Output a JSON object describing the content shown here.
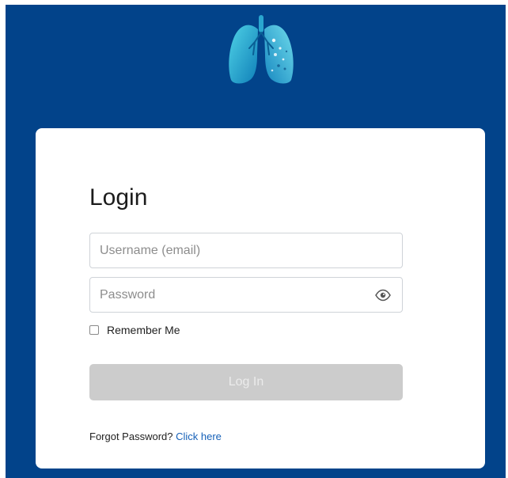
{
  "login": {
    "title": "Login",
    "username_placeholder": "Username (email)",
    "password_placeholder": "Password",
    "remember_label": "Remember Me",
    "submit_label": "Log In",
    "forgot_prefix": "Forgot Password?",
    "forgot_link": "Click here"
  },
  "icons": {
    "logo": "lungs-logo-icon",
    "password_toggle": "eye-icon"
  },
  "colors": {
    "background": "#02438a",
    "card": "#ffffff",
    "button_disabled": "#cccccc",
    "link": "#1560b8"
  }
}
